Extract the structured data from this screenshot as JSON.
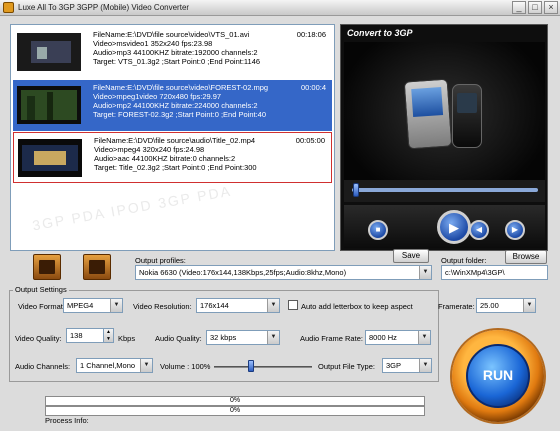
{
  "window": {
    "title": "Luxe All To 3GP 3GPP (Mobile) Video Converter",
    "buttons": [
      "_",
      "□",
      "×"
    ]
  },
  "files": [
    {
      "filename": "FileName:E:\\DVD\\file source\\video\\VTS_01.avi",
      "duration": "00:18:06",
      "video": "Video>msvideo1   352x240  fps:23.98",
      "audio": "Audio>mp3    44100KHZ  bitrate:192000  channels:2",
      "target": "Target: VTS_01.3g2 ;Start Point:0 ;End Point:1146",
      "selected": false
    },
    {
      "filename": "FileName:E:\\DVD\\file source\\video\\FOREST-02.mpg",
      "duration": "00:00:4",
      "video": "Video>mpeg1video  720x480  fps:29.97",
      "audio": "Audio>mp2    44100KHZ  bitrate:224000  channels:2",
      "target": "Target: FOREST-02.3g2 ;Start Point:0 ;End Point:40",
      "selected": true
    },
    {
      "filename": "FileName:E:\\DVD\\file source\\audio\\Title_02.mp4",
      "duration": "00:05:00",
      "video": "Video>mpeg4  320x240  fps:24.98",
      "audio": "Audio>aac    44100KHZ  bitrate:0  channels:2",
      "target": "Target: Title_02.3g2 ;Start Point:0 ;End Point:300",
      "selected": false
    }
  ],
  "watermark": "3GP PDA IPOD 3GP PDA",
  "preview": {
    "title": "Convert to 3GP",
    "seek_position": 0.03
  },
  "profile": {
    "label": "Output profiles:",
    "value": "Nokia 6630 (Video:176x144,138Kbps,25fps;Audio:8khz,Mono)",
    "save_label": "Save",
    "folder_label": "Output folder:",
    "folder_value": "c:\\WinXMp4\\3GP\\",
    "browse_label": "Browse"
  },
  "output_settings": {
    "title": "Output Settings",
    "video_format_label": "Video Format:",
    "video_format": "MPEG4",
    "video_resolution_label": "Video Resolution:",
    "video_resolution": "176x144",
    "letterbox_label": "Auto add letterbox to keep aspect",
    "framerate_label": "Framerate:",
    "framerate": "25.00",
    "video_quality_label": "Video Quality:",
    "video_quality": "138",
    "kbps_label": "Kbps",
    "audio_quality_label": "Audio Quality:",
    "audio_quality": "32 kbps",
    "audio_frame_rate_label": "Audio Frame Rate:",
    "audio_frame_rate": "8000 Hz",
    "audio_channels_label": "Audio Channels:",
    "audio_channels": "1 Channel,Mono",
    "volume_label": "Volume : 100%",
    "volume": 1.0,
    "file_type_label": "Output File Type:",
    "file_type": "3GP"
  },
  "run_label": "RUN",
  "progress": {
    "bar1": "0%",
    "bar2": "0%",
    "info_label": "Process Info:"
  }
}
